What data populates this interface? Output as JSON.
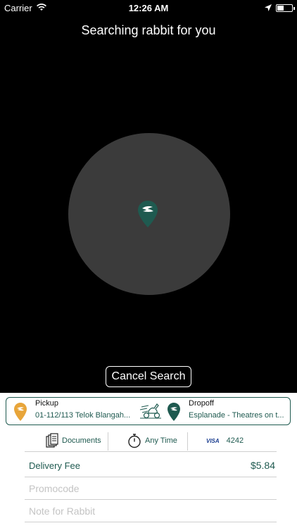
{
  "status_bar": {
    "carrier": "Carrier",
    "time": "12:26 AM"
  },
  "search": {
    "title": "Searching rabbit for you",
    "cancel_label": "Cancel Search"
  },
  "route": {
    "pickup_label": "Pickup",
    "pickup_address": "01-112/113 Telok Blangah...",
    "dropoff_label": "Dropoff",
    "dropoff_address": "Esplanade - Theatres on t..."
  },
  "options": {
    "documents": "Documents",
    "time": "Any Time",
    "card_brand": "VISA",
    "card_last4": "4242"
  },
  "fee": {
    "label": "Delivery Fee",
    "amount": "$5.84"
  },
  "promo": {
    "placeholder": "Promocode"
  },
  "note": {
    "placeholder": "Note for Rabbit"
  },
  "colors": {
    "brand": "#1f5a50",
    "pickup": "#e8a53a",
    "radar": "#3b3b3b"
  }
}
